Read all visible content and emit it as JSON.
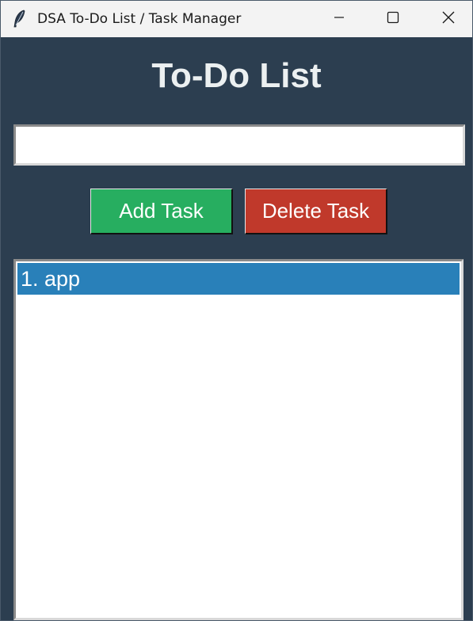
{
  "window": {
    "title": "DSA To-Do List / Task Manager",
    "controls": [
      "minimize",
      "maximize",
      "close"
    ]
  },
  "colors": {
    "background": "#2c3e50",
    "heading": "#ecf0f1",
    "add_button": "#27ae60",
    "delete_button": "#c0392b",
    "selection": "#2980b9"
  },
  "header": {
    "title": "To-Do List"
  },
  "entry": {
    "value": "",
    "placeholder": ""
  },
  "buttons": {
    "add_label": "Add Task",
    "delete_label": "Delete Task"
  },
  "tasks": [
    {
      "label": "1. app",
      "selected": true
    }
  ],
  "icons": {
    "app": "feather-icon",
    "minimize": "minimize-icon",
    "maximize": "maximize-icon",
    "close": "close-icon"
  }
}
